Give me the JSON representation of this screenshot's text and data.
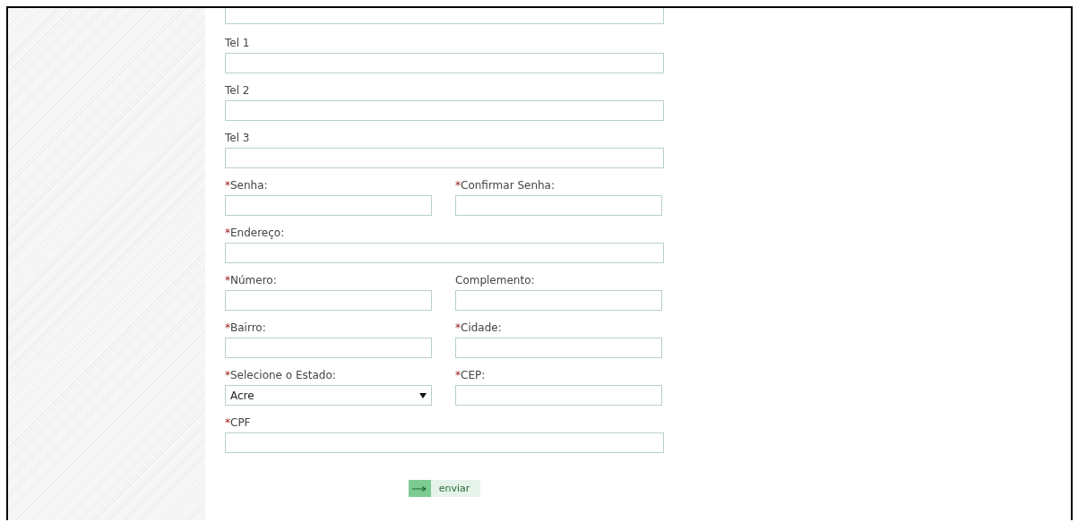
{
  "form": {
    "rows": [
      {
        "fields": [
          {
            "kind": "text"
          }
        ]
      },
      {
        "fields": [
          {
            "kind": "text",
            "label": "Tel 1"
          }
        ]
      },
      {
        "fields": [
          {
            "kind": "text",
            "label": "Tel 2"
          }
        ]
      },
      {
        "fields": [
          {
            "kind": "text",
            "label": "Tel 3"
          }
        ]
      },
      {
        "fields": [
          {
            "kind": "text",
            "mark": "*",
            "label": "Senha:"
          },
          {
            "kind": "text",
            "mark": "*",
            "label": "Confirmar Senha:"
          }
        ]
      },
      {
        "fields": [
          {
            "kind": "text",
            "mark": "*",
            "label": "Endereço:"
          }
        ]
      },
      {
        "fields": [
          {
            "kind": "text",
            "mark": "*",
            "label": "Número:"
          },
          {
            "kind": "text",
            "label": "Complemento:"
          }
        ]
      },
      {
        "fields": [
          {
            "kind": "text",
            "mark": "*",
            "label": "Bairro:"
          },
          {
            "kind": "text",
            "mark": "*",
            "label": "Cidade:"
          }
        ]
      },
      {
        "fields": [
          {
            "kind": "select",
            "mark": "*",
            "label": "Selecione o Estado:",
            "value": "Acre"
          },
          {
            "kind": "text",
            "mark": "*",
            "label": "CEP:"
          }
        ]
      },
      {
        "fields": [
          {
            "kind": "text",
            "mark": "*",
            "label": "CPF"
          }
        ]
      }
    ],
    "submit": {
      "label": "enviar"
    }
  }
}
